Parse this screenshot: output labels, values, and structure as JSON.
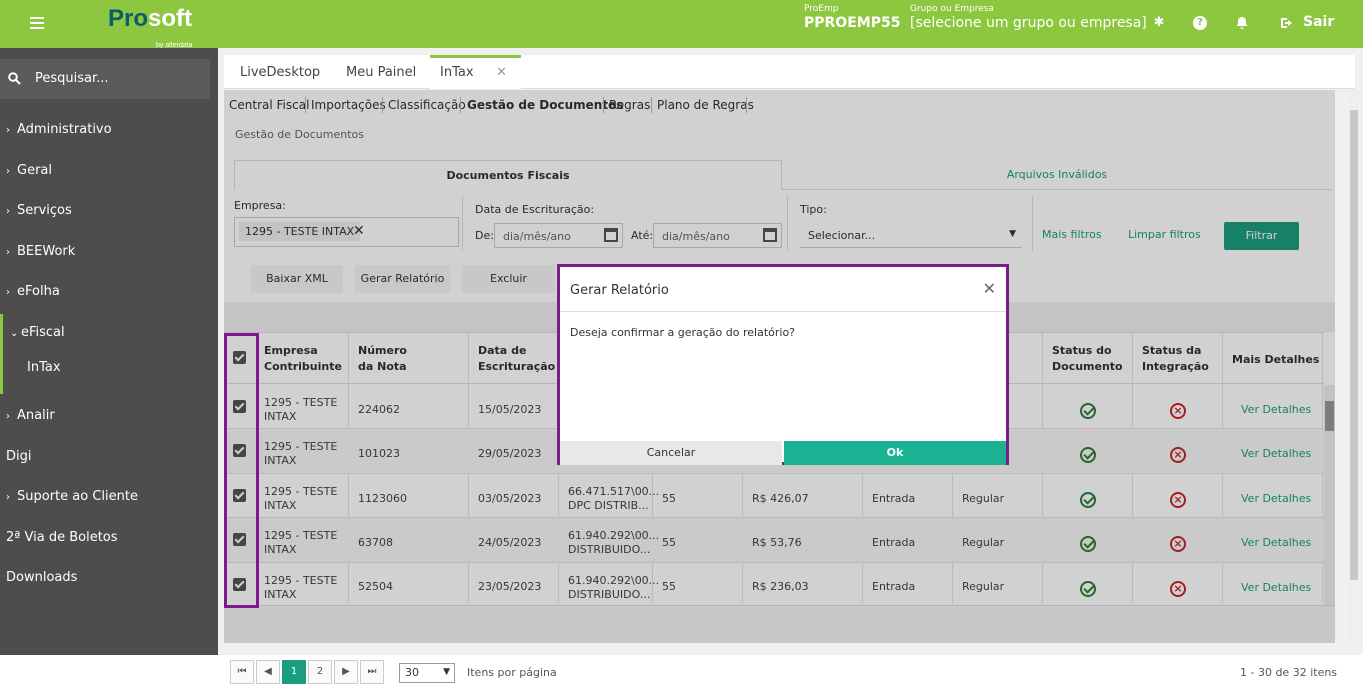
{
  "header": {
    "logo_pro": "Pro",
    "logo_soft": "soft",
    "logo_by": "by alterdata",
    "proemp_label": "ProEmp",
    "proemp_value": "PPROEMP55",
    "grupo_label": "Grupo ou Empresa",
    "grupo_value": "[selecione um grupo ou empresa]",
    "logout_label": "Sair"
  },
  "sidebar": {
    "search_placeholder": "Pesquisar...",
    "items": [
      {
        "label": "Administrativo"
      },
      {
        "label": "Geral"
      },
      {
        "label": "Serviços"
      },
      {
        "label": "BEEWork"
      },
      {
        "label": "eFolha"
      },
      {
        "label": "eFiscal"
      },
      {
        "label": "InTax"
      },
      {
        "label": "Analir"
      },
      {
        "label": "Digi"
      },
      {
        "label": "Suporte ao Cliente"
      },
      {
        "label": "2ª Via de Boletos"
      },
      {
        "label": "Downloads"
      }
    ]
  },
  "tabs": [
    {
      "label": "LiveDesktop"
    },
    {
      "label": "Meu Painel"
    },
    {
      "label": "InTax"
    }
  ],
  "subnav": [
    "Central Fiscal",
    "Importações",
    "Classificação",
    "Gestão de Documentos",
    "Regras",
    "Plano de Regras"
  ],
  "breadcrumb": "Gestão de Documentos",
  "doc_tabs": [
    "Documentos Fiscais",
    "Arquivos Inválidos"
  ],
  "filters": {
    "empresa_label": "Empresa:",
    "empresa_value": "1295 - TESTE INTAX",
    "data_label": "Data de Escrituração:",
    "de_label": "De:",
    "ate_label": "Até:",
    "date_placeholder": "dia/mês/ano",
    "tipo_label": "Tipo:",
    "tipo_value": "Selecionar...",
    "mais_filtros": "Mais filtros",
    "limpar_filtros": "Limpar filtros",
    "filtrar": "Filtrar"
  },
  "actions": [
    "Baixar XML",
    "Gerar Relatório",
    "Excluir"
  ],
  "table": {
    "headers": {
      "empresa": "Empresa Contribuinte",
      "numero": "Número da Nota",
      "data": "Data de Escrituração",
      "status_doc": "Status do Documento",
      "status_int": "Status da Integração",
      "detalhes": "Mais Detalhes"
    },
    "rows": [
      {
        "empresa": "1295 - TESTE INTAX",
        "numero": "224062",
        "data": "15/05/2023",
        "emitente": "",
        "modelo": "",
        "valor": "",
        "tipo": "",
        "situacao": "",
        "link": "Ver Detalhes"
      },
      {
        "empresa": "1295 - TESTE INTAX",
        "numero": "101023",
        "data": "29/05/2023",
        "emitente": "",
        "modelo": "",
        "valor": "",
        "tipo": "",
        "situacao": "",
        "link": "Ver Detalhes"
      },
      {
        "empresa": "1295 - TESTE INTAX",
        "numero": "1123060",
        "data": "03/05/2023",
        "emitente": "66.471.517\\00... DPC DISTRIB...",
        "modelo": "55",
        "valor": "R$ 426,07",
        "tipo": "Entrada",
        "situacao": "Regular",
        "link": "Ver Detalhes"
      },
      {
        "empresa": "1295 - TESTE INTAX",
        "numero": "63708",
        "data": "24/05/2023",
        "emitente": "61.940.292\\00... DISTRIBUIDO...",
        "modelo": "55",
        "valor": "R$ 53,76",
        "tipo": "Entrada",
        "situacao": "Regular",
        "link": "Ver Detalhes"
      },
      {
        "empresa": "1295 - TESTE INTAX",
        "numero": "52504",
        "data": "23/05/2023",
        "emitente": "61.940.292\\00... DISTRIBUIDO...",
        "modelo": "55",
        "valor": "R$ 236,03",
        "tipo": "Entrada",
        "situacao": "Regular",
        "link": "Ver Detalhes"
      }
    ]
  },
  "pagination": {
    "pages": [
      "1",
      "2"
    ],
    "per_page": "30",
    "per_page_label": "Itens por página",
    "summary": "1 - 30 de 32 itens"
  },
  "modal": {
    "title": "Gerar Relatório",
    "message": "Deseja confirmar a geração do relatório?",
    "cancel": "Cancelar",
    "ok": "Ok"
  }
}
